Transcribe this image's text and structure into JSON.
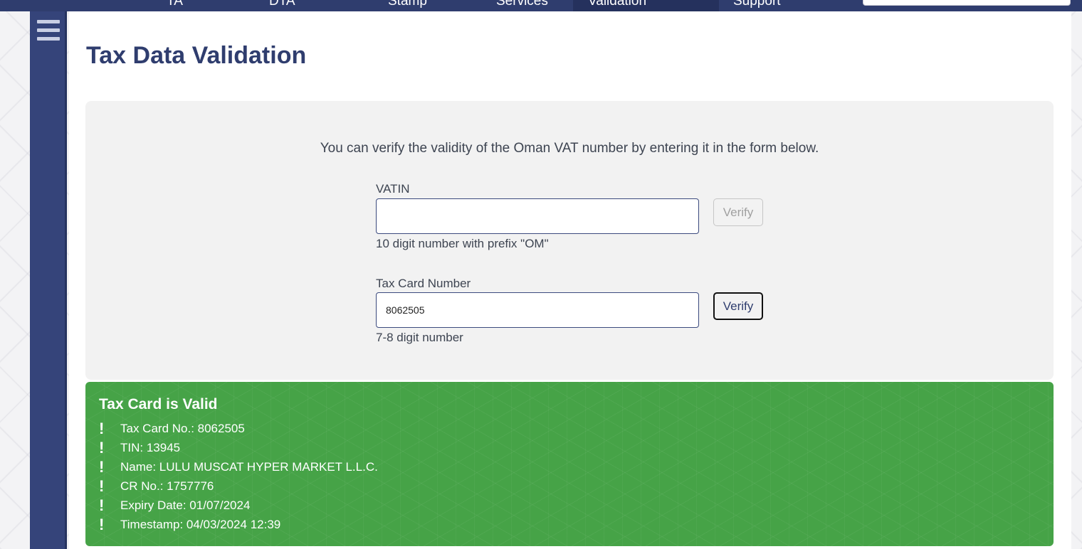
{
  "topnav": {
    "items": [
      "TA",
      "DTA",
      "Stamp",
      "Services",
      "Validation",
      "Support"
    ],
    "active": "Validation"
  },
  "sidebar": {
    "menu_icon": "hamburger-menu-icon"
  },
  "page": {
    "title": "Tax Data Validation"
  },
  "form": {
    "intro": "You can verify the validity of the Oman VAT number by entering it in the form below.",
    "vatin": {
      "label": "VATIN",
      "value": "",
      "hint": "10 digit number with prefix \"OM\"",
      "button": "Verify",
      "button_enabled": false
    },
    "taxcard": {
      "label": "Tax Card Number",
      "value": "8062505",
      "hint": "7-8 digit number",
      "button": "Verify",
      "button_enabled": true
    }
  },
  "result": {
    "title": "Tax Card is Valid",
    "status_color": "#46a347",
    "items": [
      "Tax Card No.: 8062505",
      "TIN: 13945",
      "Name: LULU MUSCAT HYPER MARKET L.L.C.",
      "CR No.: 1757776",
      "Expiry Date: 01/07/2024",
      "Timestamp: 04/03/2024 12:39"
    ],
    "item_icon": "exclamation-icon"
  },
  "colors": {
    "brand": "#2f3d6e",
    "sidebar": "#35447a",
    "panel": "#f2f2f2"
  }
}
